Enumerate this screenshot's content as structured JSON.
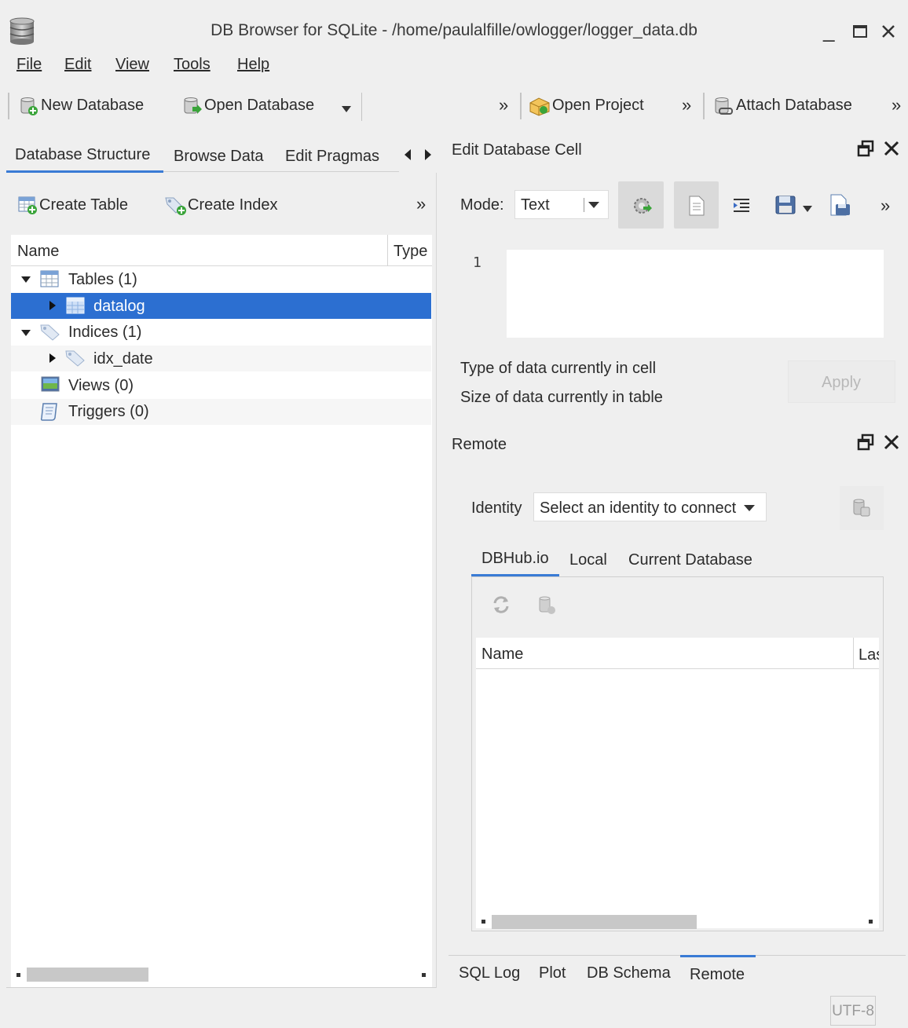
{
  "window": {
    "title": "DB Browser for SQLite - /home/paulalfille/owlogger/logger_data.db",
    "app_icon": "database-icon",
    "controls": {
      "minimize": "_",
      "maximize": "□",
      "close": "✕"
    }
  },
  "menu": {
    "file": "File",
    "edit": "Edit",
    "view": "View",
    "tools": "Tools",
    "help": "Help"
  },
  "toolbar": {
    "new_database": "New Database",
    "open_database": "Open Database",
    "overflow": "»",
    "open_project": "Open Project",
    "attach_database": "Attach Database"
  },
  "left_tabs": {
    "database_structure": "Database Structure",
    "browse_data": "Browse Data",
    "edit_pragmas": "Edit Pragmas"
  },
  "structure_toolbar": {
    "create_table": "Create Table",
    "create_index": "Create Index",
    "overflow": "»"
  },
  "tree": {
    "headers": {
      "name": "Name",
      "type": "Type"
    },
    "tables": "Tables (1)",
    "table_item": "datalog",
    "indices": "Indices (1)",
    "index_item": "idx_date",
    "views": "Views (0)",
    "triggers": "Triggers (0)"
  },
  "edit_cell": {
    "title": "Edit Database Cell",
    "mode_label": "Mode:",
    "mode_value": "Text",
    "line_number": "1",
    "type_info": "Type of data currently in cell",
    "size_info": "Size of data currently in table",
    "apply": "Apply",
    "overflow": "»"
  },
  "remote": {
    "title": "Remote",
    "identity_label": "Identity",
    "identity_value": "Select an identity to connect",
    "tabs": {
      "dbhub": "DBHub.io",
      "local": "Local",
      "current": "Current Database"
    },
    "table_headers": {
      "name": "Name",
      "last": "Las"
    }
  },
  "bottom_tabs": {
    "sql_log": "SQL Log",
    "plot": "Plot",
    "db_schema": "DB Schema",
    "remote": "Remote"
  },
  "status": {
    "encoding": "UTF-8"
  },
  "colors": {
    "accent": "#3a7bd5",
    "selection": "#2c6fd1",
    "window_bg": "#efefef"
  }
}
